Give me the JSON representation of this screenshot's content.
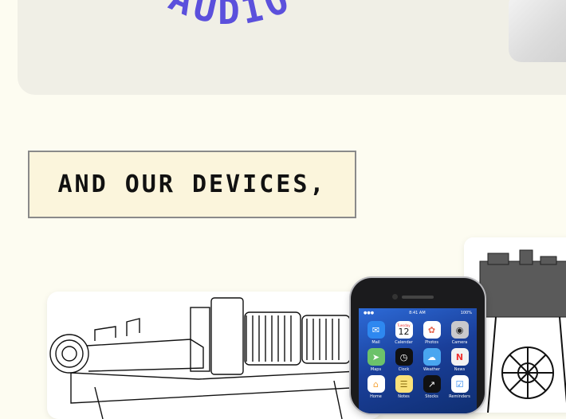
{
  "hero": {
    "title": "AUDIO"
  },
  "section": {
    "caption": "And our devices,"
  },
  "phone": {
    "status_time": "8:41 AM",
    "status_battery": "100%",
    "calendar_day": "Tuesday",
    "calendar_date": "12",
    "apps": [
      {
        "label": "Mail",
        "icon": "mail-icon",
        "color": "#2e88f0",
        "glyph": "✉"
      },
      {
        "label": "Calendar",
        "icon": "calendar-icon",
        "color": "#ffffff",
        "glyph": ""
      },
      {
        "label": "Photos",
        "icon": "photos-icon",
        "color": "#ffffff",
        "glyph": "✿"
      },
      {
        "label": "Camera",
        "icon": "camera-icon",
        "color": "#c9c9cc",
        "glyph": "◉"
      },
      {
        "label": "Maps",
        "icon": "maps-icon",
        "color": "#6cc26a",
        "glyph": "➤"
      },
      {
        "label": "Clock",
        "icon": "clock-icon",
        "color": "#111111",
        "glyph": "◷"
      },
      {
        "label": "Weather",
        "icon": "weather-icon",
        "color": "#49a6f0",
        "glyph": "☁"
      },
      {
        "label": "News",
        "icon": "news-icon",
        "color": "#f2f2f2",
        "glyph": "N"
      },
      {
        "label": "Home",
        "icon": "home-icon",
        "color": "#f6a53a",
        "glyph": "⌂"
      },
      {
        "label": "Notes",
        "icon": "notes-icon",
        "color": "#fbe27a",
        "glyph": "☰"
      },
      {
        "label": "Stocks",
        "icon": "stocks-icon",
        "color": "#111111",
        "glyph": "↗"
      },
      {
        "label": "Reminders",
        "icon": "reminders-icon",
        "color": "#ffffff",
        "glyph": "☑"
      }
    ]
  },
  "colors": {
    "accent": "#5b50dc",
    "page_bg": "#fdfcf1",
    "caption_bg": "#fbf5dc"
  }
}
